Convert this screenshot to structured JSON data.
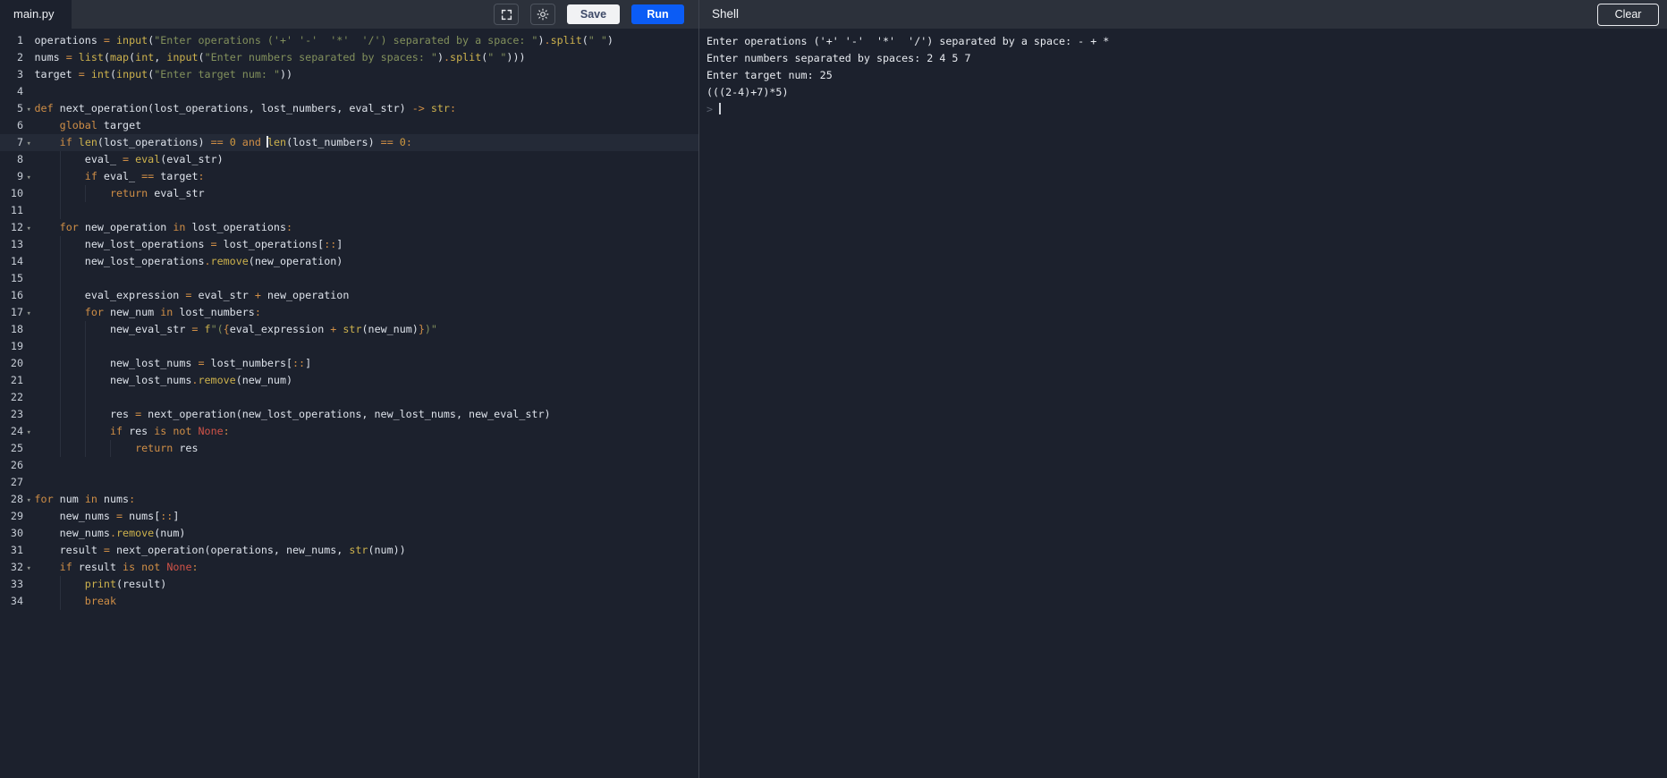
{
  "topbar": {
    "tab": "main.py",
    "save": "Save",
    "run": "Run"
  },
  "shell": {
    "title": "Shell",
    "clear": "Clear",
    "prompt": ">",
    "lines": [
      "Enter operations ('+' '-'  '*'  '/') separated by a space: - + *",
      "Enter numbers separated by spaces: 2 4 5 7",
      "Enter target num: 25",
      "(((2-4)+7)*5)"
    ]
  },
  "palette": {
    "editor_bg": "#1c212d",
    "topbar_bg": "#2c313b",
    "run_blue": "#0b5cf5",
    "save_bg": "#f1f2f4",
    "keyword_orange": "#cf8e46",
    "builtin_yellow": "#cdb24d",
    "string_olive": "#82905c",
    "number_gold": "#d19a3f",
    "none_red": "#d15348",
    "text": "#dde2ea",
    "active_line": "#242a37"
  },
  "editor": {
    "lines": [
      {
        "n": 1,
        "fold": false,
        "guides": 0,
        "active": false,
        "t": [
          [
            "tp",
            "operations "
          ],
          [
            "to",
            "="
          ],
          [
            "tp",
            " "
          ],
          [
            "tb",
            "input"
          ],
          [
            "tp",
            "("
          ],
          [
            "ts",
            "\"Enter operations ('+' '-'  '*'  '/') separated by a space: \""
          ],
          [
            "tp",
            ")"
          ],
          [
            "to",
            "."
          ],
          [
            "tb",
            "split"
          ],
          [
            "tp",
            "("
          ],
          [
            "ts",
            "\" \""
          ],
          [
            "tp",
            ")"
          ]
        ]
      },
      {
        "n": 2,
        "fold": false,
        "guides": 0,
        "active": false,
        "t": [
          [
            "tp",
            "nums "
          ],
          [
            "to",
            "="
          ],
          [
            "tp",
            " "
          ],
          [
            "tb",
            "list"
          ],
          [
            "tp",
            "("
          ],
          [
            "tb",
            "map"
          ],
          [
            "tp",
            "("
          ],
          [
            "tb",
            "int"
          ],
          [
            "tp",
            ", "
          ],
          [
            "tb",
            "input"
          ],
          [
            "tp",
            "("
          ],
          [
            "ts",
            "\"Enter numbers separated by spaces: \""
          ],
          [
            "tp",
            ")"
          ],
          [
            "to",
            "."
          ],
          [
            "tb",
            "split"
          ],
          [
            "tp",
            "("
          ],
          [
            "ts",
            "\" \""
          ],
          [
            "tp",
            ")))"
          ]
        ]
      },
      {
        "n": 3,
        "fold": false,
        "guides": 0,
        "active": false,
        "t": [
          [
            "tp",
            "target "
          ],
          [
            "to",
            "="
          ],
          [
            "tp",
            " "
          ],
          [
            "tb",
            "int"
          ],
          [
            "tp",
            "("
          ],
          [
            "tb",
            "input"
          ],
          [
            "tp",
            "("
          ],
          [
            "ts",
            "\"Enter target num: \""
          ],
          [
            "tp",
            "))"
          ]
        ]
      },
      {
        "n": 4,
        "fold": false,
        "guides": 0,
        "active": false,
        "t": []
      },
      {
        "n": 5,
        "fold": true,
        "guides": 0,
        "active": false,
        "t": [
          [
            "tk",
            "def"
          ],
          [
            "tp",
            " next_operation(lost_operations, lost_numbers, eval_str) "
          ],
          [
            "to",
            "->"
          ],
          [
            "tp",
            " "
          ],
          [
            "tb",
            "str"
          ],
          [
            "to",
            ":"
          ]
        ]
      },
      {
        "n": 6,
        "fold": false,
        "guides": 0,
        "active": false,
        "t": [
          [
            "tp",
            "    "
          ],
          [
            "tk",
            "global"
          ],
          [
            "tp",
            " target"
          ]
        ]
      },
      {
        "n": 7,
        "fold": true,
        "guides": 0,
        "active": true,
        "t": [
          [
            "tp",
            "    "
          ],
          [
            "tk",
            "if"
          ],
          [
            "tp",
            " "
          ],
          [
            "tb",
            "len"
          ],
          [
            "tp",
            "(lost_operations) "
          ],
          [
            "to",
            "=="
          ],
          [
            "tp",
            " "
          ],
          [
            "tn",
            "0"
          ],
          [
            "tp",
            " "
          ],
          [
            "tk",
            "and"
          ],
          [
            "tp",
            " "
          ],
          [
            "cur",
            ""
          ],
          [
            "tb",
            "len"
          ],
          [
            "tp",
            "(lost_numbers) "
          ],
          [
            "to",
            "=="
          ],
          [
            "tp",
            " "
          ],
          [
            "tn",
            "0"
          ],
          [
            "to",
            ":"
          ]
        ]
      },
      {
        "n": 8,
        "fold": false,
        "guides": 1,
        "active": false,
        "t": [
          [
            "tp",
            "        eval_ "
          ],
          [
            "to",
            "="
          ],
          [
            "tp",
            " "
          ],
          [
            "tb",
            "eval"
          ],
          [
            "tp",
            "(eval_str)"
          ]
        ]
      },
      {
        "n": 9,
        "fold": true,
        "guides": 1,
        "active": false,
        "t": [
          [
            "tp",
            "        "
          ],
          [
            "tk",
            "if"
          ],
          [
            "tp",
            " eval_ "
          ],
          [
            "to",
            "=="
          ],
          [
            "tp",
            " target"
          ],
          [
            "to",
            ":"
          ]
        ]
      },
      {
        "n": 10,
        "fold": false,
        "guides": 2,
        "active": false,
        "t": [
          [
            "tp",
            "            "
          ],
          [
            "tk",
            "return"
          ],
          [
            "tp",
            " eval_str"
          ]
        ]
      },
      {
        "n": 11,
        "fold": false,
        "guides": 1,
        "active": false,
        "t": []
      },
      {
        "n": 12,
        "fold": true,
        "guides": 0,
        "active": false,
        "t": [
          [
            "tp",
            "    "
          ],
          [
            "tk",
            "for"
          ],
          [
            "tp",
            " new_operation "
          ],
          [
            "tk",
            "in"
          ],
          [
            "tp",
            " lost_operations"
          ],
          [
            "to",
            ":"
          ]
        ]
      },
      {
        "n": 13,
        "fold": false,
        "guides": 1,
        "active": false,
        "t": [
          [
            "tp",
            "        new_lost_operations "
          ],
          [
            "to",
            "="
          ],
          [
            "tp",
            " lost_operations["
          ],
          [
            "to",
            "::"
          ],
          [
            "tp",
            "]"
          ]
        ]
      },
      {
        "n": 14,
        "fold": false,
        "guides": 1,
        "active": false,
        "t": [
          [
            "tp",
            "        new_lost_operations"
          ],
          [
            "to",
            "."
          ],
          [
            "tb",
            "remove"
          ],
          [
            "tp",
            "(new_operation)"
          ]
        ]
      },
      {
        "n": 15,
        "fold": false,
        "guides": 1,
        "active": false,
        "t": []
      },
      {
        "n": 16,
        "fold": false,
        "guides": 1,
        "active": false,
        "t": [
          [
            "tp",
            "        eval_expression "
          ],
          [
            "to",
            "="
          ],
          [
            "tp",
            " eval_str "
          ],
          [
            "to",
            "+"
          ],
          [
            "tp",
            " new_operation"
          ]
        ]
      },
      {
        "n": 17,
        "fold": true,
        "guides": 1,
        "active": false,
        "t": [
          [
            "tp",
            "        "
          ],
          [
            "tk",
            "for"
          ],
          [
            "tp",
            " new_num "
          ],
          [
            "tk",
            "in"
          ],
          [
            "tp",
            " lost_numbers"
          ],
          [
            "to",
            ":"
          ]
        ]
      },
      {
        "n": 18,
        "fold": false,
        "guides": 2,
        "active": false,
        "t": [
          [
            "tp",
            "            new_eval_str "
          ],
          [
            "to",
            "="
          ],
          [
            "tp",
            " "
          ],
          [
            "tb",
            "f"
          ],
          [
            "ts",
            "\"("
          ],
          [
            "to",
            "{"
          ],
          [
            "tp",
            "eval_expression "
          ],
          [
            "to",
            "+"
          ],
          [
            "tp",
            " "
          ],
          [
            "tb",
            "str"
          ],
          [
            "tp",
            "(new_num)"
          ],
          [
            "to",
            "}"
          ],
          [
            "ts",
            ")\""
          ]
        ]
      },
      {
        "n": 19,
        "fold": false,
        "guides": 2,
        "active": false,
        "t": []
      },
      {
        "n": 20,
        "fold": false,
        "guides": 2,
        "active": false,
        "t": [
          [
            "tp",
            "            new_lost_nums "
          ],
          [
            "to",
            "="
          ],
          [
            "tp",
            " lost_numbers["
          ],
          [
            "to",
            "::"
          ],
          [
            "tp",
            "]"
          ]
        ]
      },
      {
        "n": 21,
        "fold": false,
        "guides": 2,
        "active": false,
        "t": [
          [
            "tp",
            "            new_lost_nums"
          ],
          [
            "to",
            "."
          ],
          [
            "tb",
            "remove"
          ],
          [
            "tp",
            "(new_num)"
          ]
        ]
      },
      {
        "n": 22,
        "fold": false,
        "guides": 2,
        "active": false,
        "t": []
      },
      {
        "n": 23,
        "fold": false,
        "guides": 2,
        "active": false,
        "t": [
          [
            "tp",
            "            res "
          ],
          [
            "to",
            "="
          ],
          [
            "tp",
            " next_operation(new_lost_operations, new_lost_nums, new_eval_str)"
          ]
        ]
      },
      {
        "n": 24,
        "fold": true,
        "guides": 2,
        "active": false,
        "t": [
          [
            "tp",
            "            "
          ],
          [
            "tk",
            "if"
          ],
          [
            "tp",
            " res "
          ],
          [
            "tk",
            "is"
          ],
          [
            "tp",
            " "
          ],
          [
            "tk",
            "not"
          ],
          [
            "tp",
            " "
          ],
          [
            "tN",
            "None"
          ],
          [
            "to",
            ":"
          ]
        ]
      },
      {
        "n": 25,
        "fold": false,
        "guides": 3,
        "active": false,
        "t": [
          [
            "tp",
            "                "
          ],
          [
            "tk",
            "return"
          ],
          [
            "tp",
            " res"
          ]
        ]
      },
      {
        "n": 26,
        "fold": false,
        "guides": 0,
        "active": false,
        "t": []
      },
      {
        "n": 27,
        "fold": false,
        "guides": 0,
        "active": false,
        "t": []
      },
      {
        "n": 28,
        "fold": true,
        "guides": 0,
        "active": false,
        "t": [
          [
            "tk",
            "for"
          ],
          [
            "tp",
            " num "
          ],
          [
            "tk",
            "in"
          ],
          [
            "tp",
            " nums"
          ],
          [
            "to",
            ":"
          ]
        ]
      },
      {
        "n": 29,
        "fold": false,
        "guides": 0,
        "active": false,
        "t": [
          [
            "tp",
            "    new_nums "
          ],
          [
            "to",
            "="
          ],
          [
            "tp",
            " nums["
          ],
          [
            "to",
            "::"
          ],
          [
            "tp",
            "]"
          ]
        ]
      },
      {
        "n": 30,
        "fold": false,
        "guides": 0,
        "active": false,
        "t": [
          [
            "tp",
            "    new_nums"
          ],
          [
            "to",
            "."
          ],
          [
            "tb",
            "remove"
          ],
          [
            "tp",
            "(num)"
          ]
        ]
      },
      {
        "n": 31,
        "fold": false,
        "guides": 0,
        "active": false,
        "t": [
          [
            "tp",
            "    result "
          ],
          [
            "to",
            "="
          ],
          [
            "tp",
            " next_operation(operations, new_nums, "
          ],
          [
            "tb",
            "str"
          ],
          [
            "tp",
            "(num))"
          ]
        ]
      },
      {
        "n": 32,
        "fold": true,
        "guides": 0,
        "active": false,
        "t": [
          [
            "tp",
            "    "
          ],
          [
            "tk",
            "if"
          ],
          [
            "tp",
            " result "
          ],
          [
            "tk",
            "is"
          ],
          [
            "tp",
            " "
          ],
          [
            "tk",
            "not"
          ],
          [
            "tp",
            " "
          ],
          [
            "tN",
            "None"
          ],
          [
            "to",
            ":"
          ]
        ]
      },
      {
        "n": 33,
        "fold": false,
        "guides": 1,
        "active": false,
        "t": [
          [
            "tp",
            "        "
          ],
          [
            "tb",
            "print"
          ],
          [
            "tp",
            "(result)"
          ]
        ]
      },
      {
        "n": 34,
        "fold": false,
        "guides": 1,
        "active": false,
        "t": [
          [
            "tp",
            "        "
          ],
          [
            "tk",
            "break"
          ]
        ]
      }
    ]
  }
}
